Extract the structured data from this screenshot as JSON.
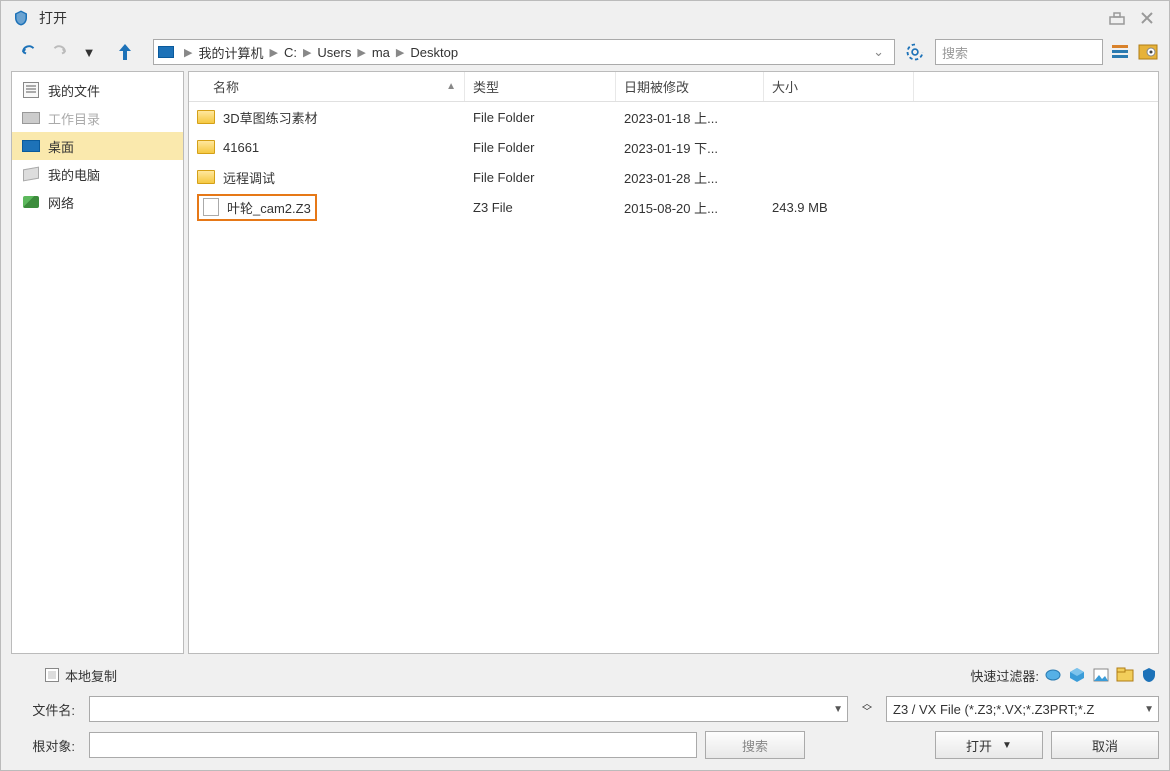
{
  "window": {
    "title": "打开"
  },
  "breadcrumb": [
    "我的计算机",
    "C:",
    "Users",
    "ma",
    "Desktop"
  ],
  "sidebar": [
    {
      "label": "我的文件",
      "icon": "doc",
      "state": "normal"
    },
    {
      "label": "工作目录",
      "icon": "monitor-gray",
      "state": "disabled"
    },
    {
      "label": "桌面",
      "icon": "monitor",
      "state": "selected"
    },
    {
      "label": "我的电脑",
      "icon": "pc",
      "state": "normal"
    },
    {
      "label": "网络",
      "icon": "net",
      "state": "normal"
    }
  ],
  "columns": {
    "name": "名称",
    "type": "类型",
    "date": "日期被修改",
    "size": "大小"
  },
  "files": [
    {
      "name": "3D草图练习素材",
      "type": "File Folder",
      "date": "2023-01-18 上...",
      "size": "",
      "icon": "folder",
      "highlight": false
    },
    {
      "name": "41661",
      "type": "File Folder",
      "date": "2023-01-19 下...",
      "size": "",
      "icon": "folder",
      "highlight": false
    },
    {
      "name": "远程调试",
      "type": "File Folder",
      "date": "2023-01-28 上...",
      "size": "",
      "icon": "folder",
      "highlight": false
    },
    {
      "name": "叶轮_cam2.Z3",
      "type": "Z3 File",
      "date": "2015-08-20 上...",
      "size": "243.9 MB",
      "icon": "file",
      "highlight": true
    }
  ],
  "bottom": {
    "local_copy": "本地复制",
    "quick_filter_label": "快速过滤器:",
    "filename_label": "文件名:",
    "root_object_label": "根对象:",
    "search_button": "搜索",
    "open_button": "打开",
    "cancel_button": "取消",
    "filetype": "Z3 / VX File (*.Z3;*.VX;*.Z3PRT;*.Z",
    "search_placeholder": "搜索"
  }
}
